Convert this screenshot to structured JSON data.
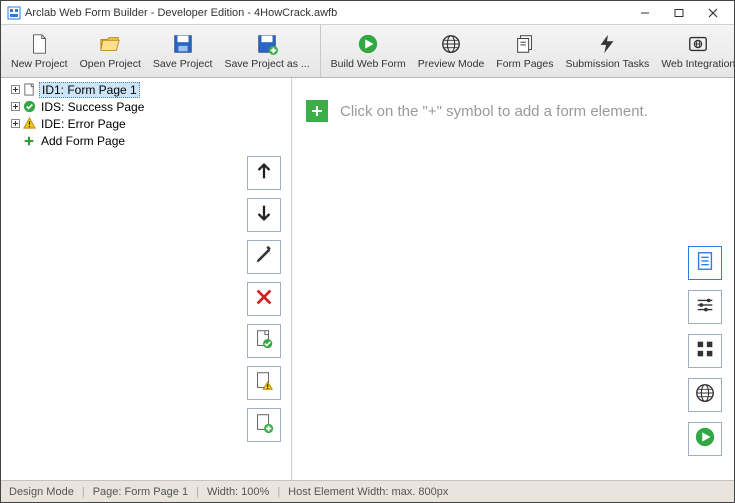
{
  "titlebar": {
    "title": "Arclab Web Form Builder - Developer Edition - 4HowCrack.awfb"
  },
  "toolbar": {
    "left": [
      {
        "name": "new-project-button",
        "label": "New Project",
        "icon": "file-new"
      },
      {
        "name": "open-project-button",
        "label": "Open Project",
        "icon": "folder-open"
      },
      {
        "name": "save-project-button",
        "label": "Save Project",
        "icon": "save"
      },
      {
        "name": "save-project-as-button",
        "label": "Save Project as ...",
        "icon": "save-plus"
      }
    ],
    "right": [
      {
        "name": "build-web-form-button",
        "label": "Build Web Form",
        "icon": "play-green"
      },
      {
        "name": "preview-mode-button",
        "label": "Preview Mode",
        "icon": "globe"
      },
      {
        "name": "form-pages-button",
        "label": "Form Pages",
        "icon": "pages"
      },
      {
        "name": "submission-tasks-button",
        "label": "Submission Tasks",
        "icon": "bolt"
      },
      {
        "name": "web-integration-button",
        "label": "Web Integration",
        "icon": "embed"
      }
    ]
  },
  "tree": {
    "items": [
      {
        "name": "tree-item-form-page-1",
        "label": "ID1: Form Page 1",
        "icon": "page",
        "selected": true,
        "expandable": true
      },
      {
        "name": "tree-item-success-page",
        "label": "IDS: Success Page",
        "icon": "check-green",
        "selected": false,
        "expandable": true
      },
      {
        "name": "tree-item-error-page",
        "label": "IDE: Error Page",
        "icon": "warning",
        "selected": false,
        "expandable": true
      },
      {
        "name": "tree-item-add-form-page",
        "label": "Add Form Page",
        "icon": "plus-green",
        "selected": false,
        "expandable": false
      }
    ]
  },
  "vstack": [
    {
      "name": "move-up-button",
      "icon": "arrow-up"
    },
    {
      "name": "move-down-button",
      "icon": "arrow-down"
    },
    {
      "name": "edit-button",
      "icon": "pencil"
    },
    {
      "name": "delete-button",
      "icon": "x-red"
    },
    {
      "name": "page-success-button",
      "icon": "page-check"
    },
    {
      "name": "page-warning-button",
      "icon": "page-warning"
    },
    {
      "name": "page-add-button",
      "icon": "page-plus"
    }
  ],
  "canvas": {
    "hint": "Click on the \"+\" symbol to add a form element."
  },
  "rstack": [
    {
      "name": "page-properties-button",
      "icon": "page-lines",
      "active": true
    },
    {
      "name": "sliders-button",
      "icon": "sliders",
      "active": false
    },
    {
      "name": "grid-button",
      "icon": "grid",
      "active": false
    },
    {
      "name": "globe-button",
      "icon": "globe2",
      "active": false
    },
    {
      "name": "run-button",
      "icon": "play-green2",
      "active": false
    }
  ],
  "statusbar": {
    "mode": "Design Mode",
    "page": "Page: Form Page 1",
    "width": "Width: 100%",
    "host": "Host Element Width: max. 800px"
  }
}
